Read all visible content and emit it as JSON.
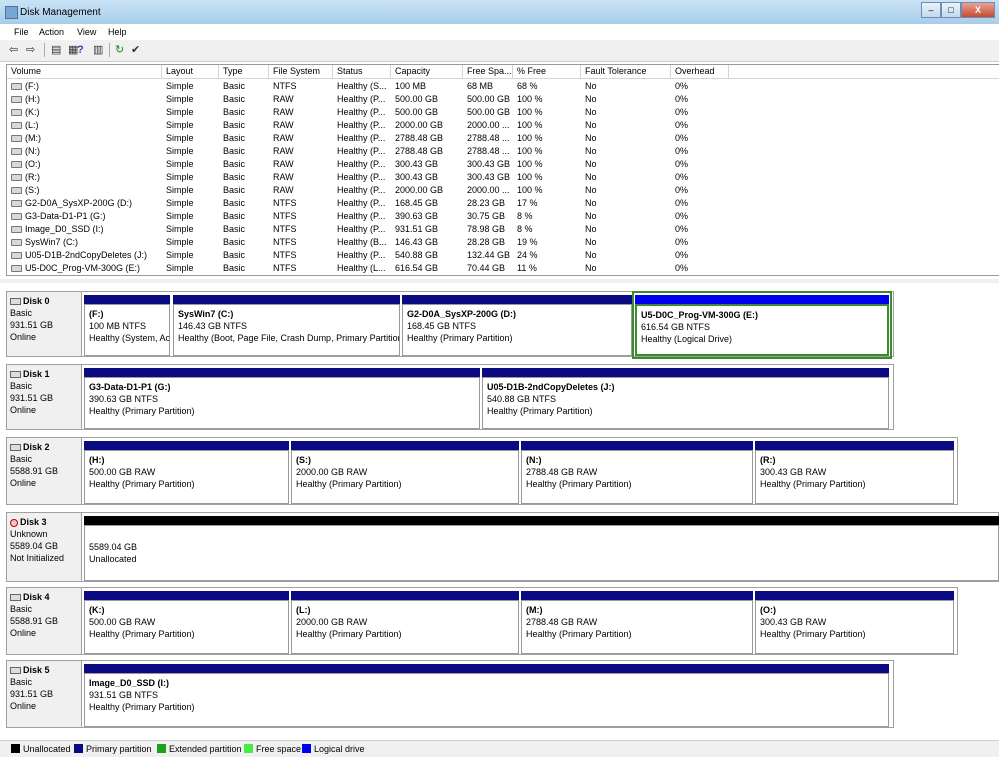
{
  "window": {
    "title": "Disk Management",
    "min": "–",
    "max": "□",
    "close": "X"
  },
  "menu": [
    "File",
    "Action",
    "View",
    "Help"
  ],
  "toolbar": {
    "back": "⇦",
    "forward": "⇨",
    "b1": "▤",
    "b2": "▦",
    "b3": "?",
    "b4": "▥",
    "b5": "↻",
    "b6": "✔"
  },
  "columns": [
    "Volume",
    "Layout",
    "Type",
    "File System",
    "Status",
    "Capacity",
    "Free Spa...",
    "% Free",
    "Fault Tolerance",
    "Overhead"
  ],
  "volumes": [
    [
      "(F:)",
      "Simple",
      "Basic",
      "NTFS",
      "Healthy (S...",
      "100 MB",
      "68 MB",
      "68 %",
      "No",
      "0%"
    ],
    [
      "(H:)",
      "Simple",
      "Basic",
      "RAW",
      "Healthy (P...",
      "500.00 GB",
      "500.00 GB",
      "100 %",
      "No",
      "0%"
    ],
    [
      "(K:)",
      "Simple",
      "Basic",
      "RAW",
      "Healthy (P...",
      "500.00 GB",
      "500.00 GB",
      "100 %",
      "No",
      "0%"
    ],
    [
      "(L:)",
      "Simple",
      "Basic",
      "RAW",
      "Healthy (P...",
      "2000.00 GB",
      "2000.00 ...",
      "100 %",
      "No",
      "0%"
    ],
    [
      "(M:)",
      "Simple",
      "Basic",
      "RAW",
      "Healthy (P...",
      "2788.48 GB",
      "2788.48 ...",
      "100 %",
      "No",
      "0%"
    ],
    [
      "(N:)",
      "Simple",
      "Basic",
      "RAW",
      "Healthy (P...",
      "2788.48 GB",
      "2788.48 ...",
      "100 %",
      "No",
      "0%"
    ],
    [
      "(O:)",
      "Simple",
      "Basic",
      "RAW",
      "Healthy (P...",
      "300.43 GB",
      "300.43 GB",
      "100 %",
      "No",
      "0%"
    ],
    [
      "(R:)",
      "Simple",
      "Basic",
      "RAW",
      "Healthy (P...",
      "300.43 GB",
      "300.43 GB",
      "100 %",
      "No",
      "0%"
    ],
    [
      "(S:)",
      "Simple",
      "Basic",
      "RAW",
      "Healthy (P...",
      "2000.00 GB",
      "2000.00 ...",
      "100 %",
      "No",
      "0%"
    ],
    [
      "G2-D0A_SysXP-200G (D:)",
      "Simple",
      "Basic",
      "NTFS",
      "Healthy (P...",
      "168.45 GB",
      "28.23 GB",
      "17 %",
      "No",
      "0%"
    ],
    [
      "G3-Data-D1-P1 (G:)",
      "Simple",
      "Basic",
      "NTFS",
      "Healthy (P...",
      "390.63 GB",
      "30.75 GB",
      "8 %",
      "No",
      "0%"
    ],
    [
      "Image_D0_SSD (I:)",
      "Simple",
      "Basic",
      "NTFS",
      "Healthy (P...",
      "931.51 GB",
      "78.98 GB",
      "8 %",
      "No",
      "0%"
    ],
    [
      "SysWin7 (C:)",
      "Simple",
      "Basic",
      "NTFS",
      "Healthy (B...",
      "146.43 GB",
      "28.28 GB",
      "19 %",
      "No",
      "0%"
    ],
    [
      "U05-D1B-2ndCopyDeletes (J:)",
      "Simple",
      "Basic",
      "NTFS",
      "Healthy (P...",
      "540.88 GB",
      "132.44 GB",
      "24 %",
      "No",
      "0%"
    ],
    [
      "U5-D0C_Prog-VM-300G (E:)",
      "Simple",
      "Basic",
      "NTFS",
      "Healthy (L...",
      "616.54 GB",
      "70.44 GB",
      "11 %",
      "No",
      "0%"
    ]
  ],
  "disks": [
    {
      "name": "Disk 0",
      "type": "Basic",
      "size": "931.51 GB",
      "state": "Online",
      "partitions": [
        {
          "name": "(F:)",
          "size": "100 MB NTFS",
          "status": "Healthy (System, Ac"
        },
        {
          "name": "SysWin7  (C:)",
          "size": "146.43 GB NTFS",
          "status": "Healthy (Boot, Page File, Crash Dump, Primary Partition"
        },
        {
          "name": "G2-D0A_SysXP-200G  (D:)",
          "size": "168.45 GB NTFS",
          "status": "Healthy (Primary Partition)"
        },
        {
          "name": "U5-D0C_Prog-VM-300G  (E:)",
          "size": "616.54 GB NTFS",
          "status": "Healthy (Logical Drive)"
        }
      ]
    },
    {
      "name": "Disk 1",
      "type": "Basic",
      "size": "931.51 GB",
      "state": "Online",
      "partitions": [
        {
          "name": "G3-Data-D1-P1  (G:)",
          "size": "390.63 GB NTFS",
          "status": "Healthy (Primary Partition)"
        },
        {
          "name": "U05-D1B-2ndCopyDeletes  (J:)",
          "size": "540.88 GB NTFS",
          "status": "Healthy (Primary Partition)"
        }
      ]
    },
    {
      "name": "Disk 2",
      "type": "Basic",
      "size": "5588.91 GB",
      "state": "Online",
      "partitions": [
        {
          "name": "(H:)",
          "size": "500.00 GB RAW",
          "status": "Healthy (Primary Partition)"
        },
        {
          "name": "(S:)",
          "size": "2000.00 GB RAW",
          "status": "Healthy (Primary Partition)"
        },
        {
          "name": "(N:)",
          "size": "2788.48 GB RAW",
          "status": "Healthy (Primary Partition)"
        },
        {
          "name": "(R:)",
          "size": "300.43 GB RAW",
          "status": "Healthy (Primary Partition)"
        }
      ]
    },
    {
      "name": "Disk 3",
      "type": "Unknown",
      "size": "5589.04 GB",
      "state": "Not Initialized",
      "partitions": [
        {
          "name": "",
          "size": "5589.04 GB",
          "status": "Unallocated"
        }
      ]
    },
    {
      "name": "Disk 4",
      "type": "Basic",
      "size": "5588.91 GB",
      "state": "Online",
      "partitions": [
        {
          "name": "(K:)",
          "size": "500.00 GB RAW",
          "status": "Healthy (Primary Partition)"
        },
        {
          "name": "(L:)",
          "size": "2000.00 GB RAW",
          "status": "Healthy (Primary Partition)"
        },
        {
          "name": "(M:)",
          "size": "2788.48 GB RAW",
          "status": "Healthy (Primary Partition)"
        },
        {
          "name": "(O:)",
          "size": "300.43 GB RAW",
          "status": "Healthy (Primary Partition)"
        }
      ]
    },
    {
      "name": "Disk 5",
      "type": "Basic",
      "size": "931.51 GB",
      "state": "Online",
      "partitions": [
        {
          "name": "Image_D0_SSD  (I:)",
          "size": "931.51 GB NTFS",
          "status": "Healthy (Primary Partition)"
        }
      ]
    }
  ],
  "legend": [
    {
      "label": "Unallocated",
      "color": "#000000"
    },
    {
      "label": "Primary partition",
      "color": "#0a0a82"
    },
    {
      "label": "Extended partition",
      "color": "#1e9e1e"
    },
    {
      "label": "Free space",
      "color": "#44ee44"
    },
    {
      "label": "Logical drive",
      "color": "#0000f0"
    }
  ]
}
